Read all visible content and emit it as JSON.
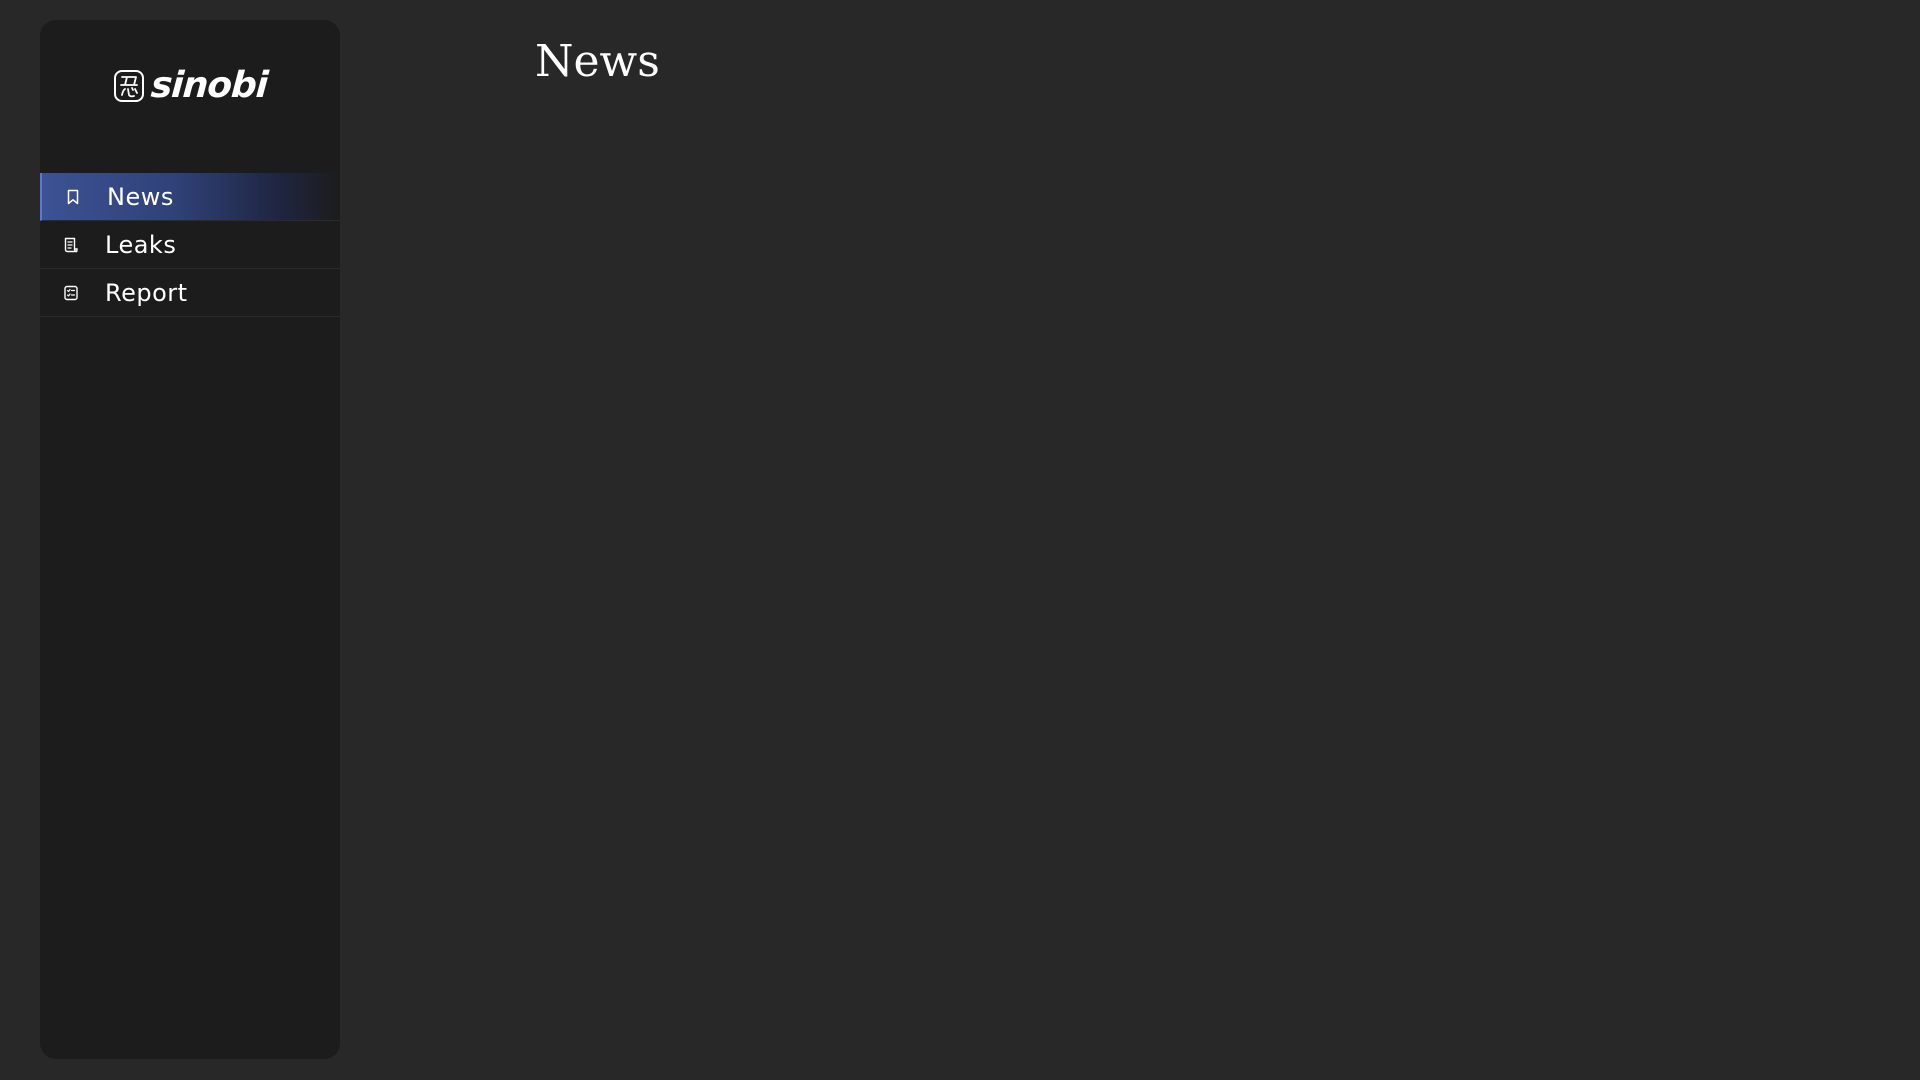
{
  "sidebar": {
    "logo": {
      "text": "sinobi",
      "icon": "ninja-kanji-logo-icon"
    },
    "items": [
      {
        "label": "News",
        "icon": "bookmark-icon",
        "active": true
      },
      {
        "label": "Leaks",
        "icon": "document-list-icon",
        "active": false
      },
      {
        "label": "Report",
        "icon": "checklist-icon",
        "active": false
      }
    ]
  },
  "main": {
    "title": "News"
  },
  "colors": {
    "background": "#282828",
    "sidebar": "#1c1c1c",
    "accent": "#3d5294",
    "text": "#ffffff"
  }
}
